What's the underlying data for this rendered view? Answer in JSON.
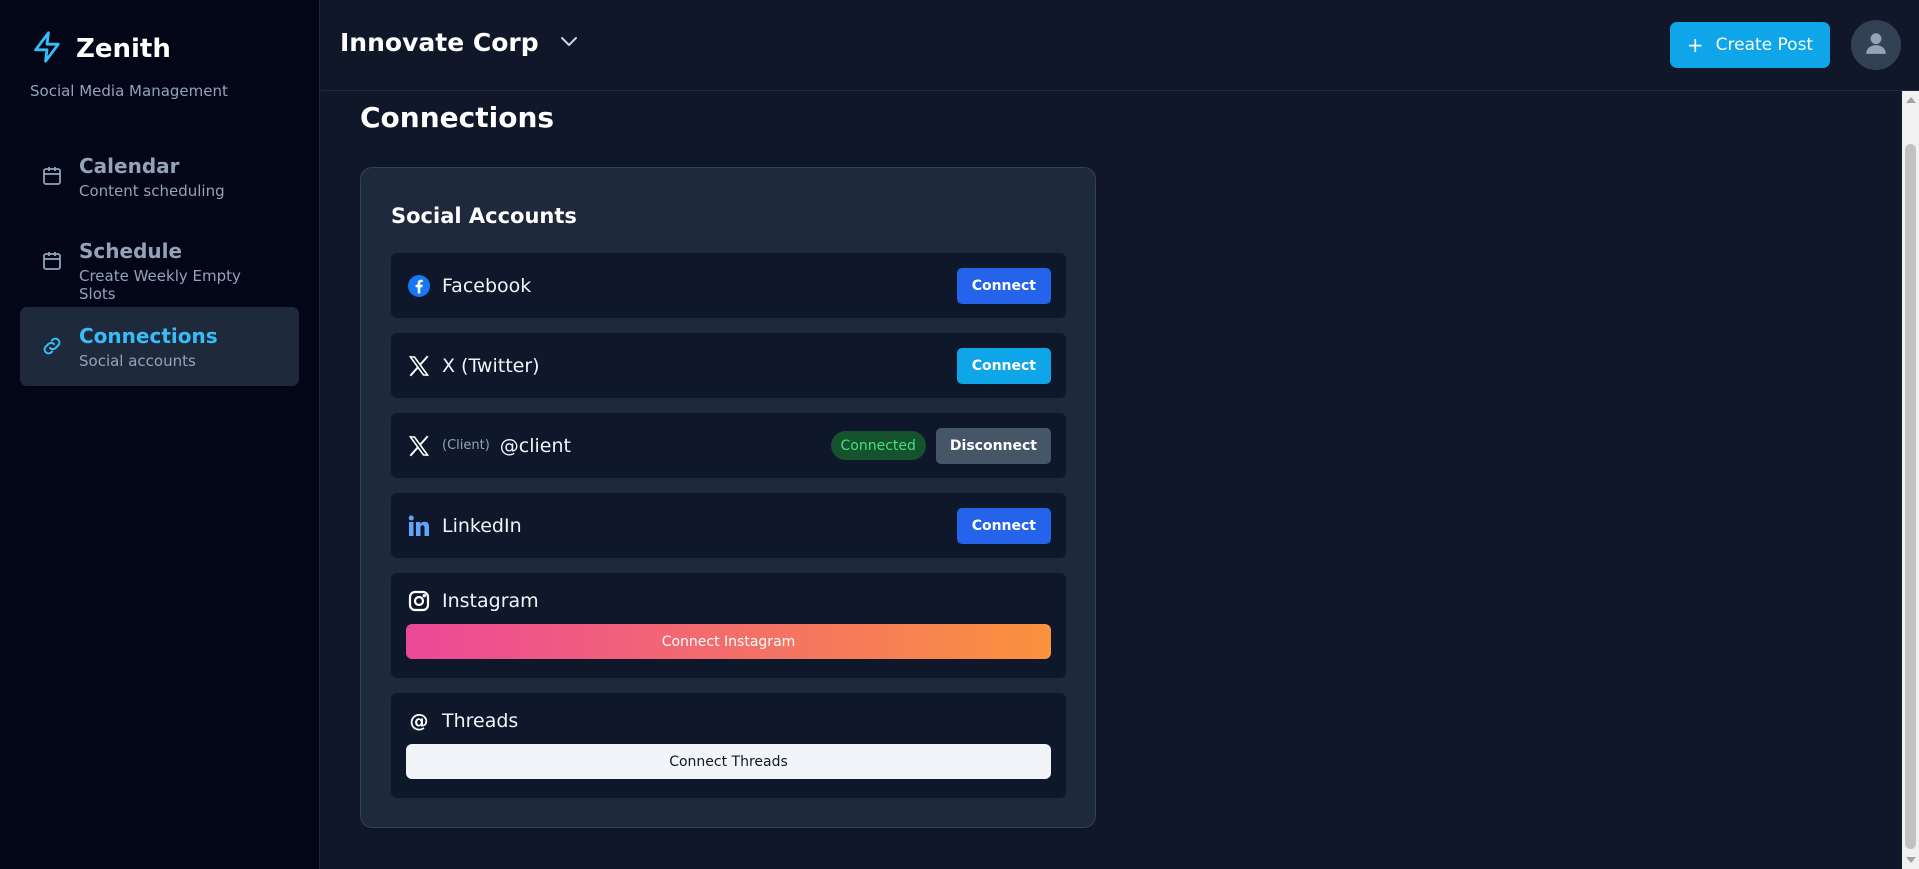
{
  "brand": {
    "name": "Zenith",
    "subtitle": "Social Media Management"
  },
  "nav": {
    "items": [
      {
        "title": "Calendar",
        "subtitle": "Content scheduling",
        "icon": "calendar-icon"
      },
      {
        "title": "Schedule",
        "subtitle": "Create Weekly Empty Slots",
        "icon": "calendar-icon"
      },
      {
        "title": "Connections",
        "subtitle": "Social accounts",
        "icon": "link-icon",
        "active": true
      }
    ]
  },
  "header": {
    "org_name": "Innovate Corp",
    "create_label": "Create Post"
  },
  "page": {
    "title": "Connections"
  },
  "card": {
    "title": "Social Accounts",
    "facebook": {
      "name": "Facebook",
      "button": "Connect"
    },
    "twitter": {
      "name": "X (Twitter)",
      "button": "Connect"
    },
    "twitter_client": {
      "tag": "(Client)",
      "handle": "@client",
      "status": "Connected",
      "button": "Disconnect"
    },
    "linkedin": {
      "name": "LinkedIn",
      "button": "Connect"
    },
    "instagram": {
      "name": "Instagram",
      "button": "Connect Instagram"
    },
    "threads": {
      "name": "Threads",
      "glyph": "@",
      "button": "Connect Threads"
    }
  },
  "colors": {
    "accent": "#0ea5e9",
    "facebook": "#1877f2",
    "linkedin": "#60a5fa",
    "connected": "#4ade80"
  }
}
